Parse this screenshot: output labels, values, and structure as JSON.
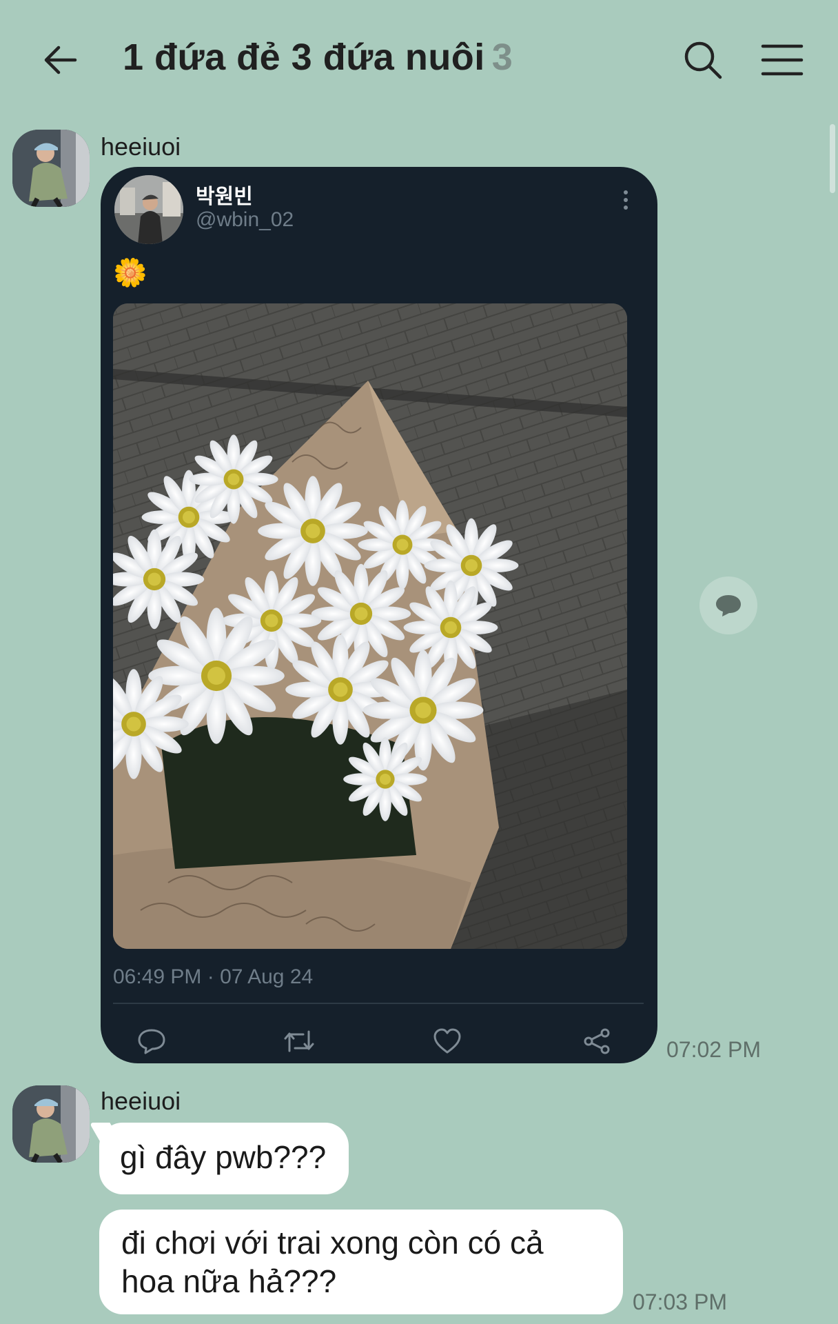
{
  "header": {
    "title": "1 đứa đẻ 3 đứa nuôi",
    "member_count": "3",
    "icons": {
      "back": "arrow-left-icon",
      "search": "search-icon",
      "menu": "hamburger-menu-icon"
    }
  },
  "messages": [
    {
      "sender": "heeiuoi",
      "type": "shared-tweet",
      "time": "07:02 PM",
      "tweet": {
        "name": "박원빈",
        "handle": "@wbin_02",
        "text": "🌼",
        "photo": "bouquet-of-white-daisies-photo",
        "date": "06:49 PM · 07 Aug 24",
        "actions": [
          "reply-icon",
          "retweet-icon",
          "like-icon",
          "share-icon"
        ]
      }
    },
    {
      "sender": "heeiuoi",
      "type": "text",
      "bubbles": [
        "gì đây pwb???",
        "đi chơi với trai xong còn có cả hoa nữa hả???"
      ],
      "time": "07:03 PM"
    }
  ],
  "colors": {
    "background": "#a9cbbd",
    "tweet_card": "#15202b",
    "bubble": "#ffffff",
    "muted_text": "#5f6f69"
  }
}
